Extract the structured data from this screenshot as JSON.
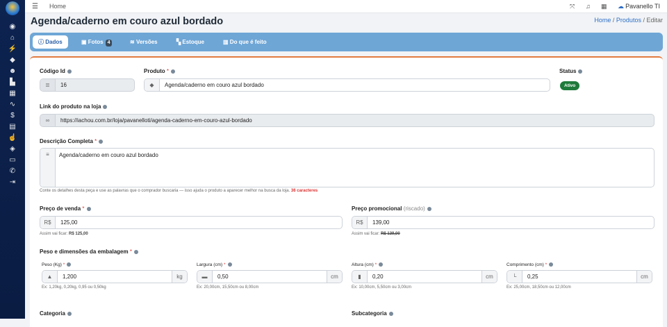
{
  "topbar": {
    "menu_icon": "menu-icon",
    "home": "Home",
    "user": "Pavanello TI"
  },
  "header": {
    "title": "Agenda/caderno em couro azul bordado",
    "crumb_home": "Home",
    "crumb_products": "Produtos",
    "crumb_edit": "Editar"
  },
  "tabs": [
    {
      "label": "Dados",
      "icon": "info-icon"
    },
    {
      "label": "Fotos",
      "icon": "images-icon",
      "badge": "4"
    },
    {
      "label": "Versões",
      "icon": "layers-icon"
    },
    {
      "label": "Estoque",
      "icon": "boxes-icon"
    },
    {
      "label": "Do que é feito",
      "icon": "trash-icon"
    }
  ],
  "form": {
    "codigo": {
      "label": "Código Id",
      "value": "16"
    },
    "produto": {
      "label": "Produto",
      "required": "*",
      "value": "Agenda/caderno em couro azul bordado"
    },
    "status": {
      "label": "Status",
      "value": "Ativo"
    },
    "link": {
      "label": "Link do produto na loja",
      "value": "https://iachou.com.br/loja/pavanelloti/agenda-caderno-em-couro-azul-bordado"
    },
    "descricao": {
      "label": "Descrição Completa",
      "required": "*",
      "value": "Agenda/caderno em couro azul bordado",
      "help": "Conte os detalhes desta peça e use as palavras que o comprador buscaria — isso ajuda o produto a aparecer melhor na busca da loja.",
      "count": "36 caracteres"
    },
    "preco": {
      "label": "Preço de venda",
      "required": "*",
      "prefix": "R$",
      "value": "125,00",
      "help_prefix": "Assim vai ficar:",
      "help_value": "R$ 125,00"
    },
    "promo": {
      "label": "Preço promocional",
      "label_note": "(riscado)",
      "prefix": "R$",
      "value": "139,00",
      "help_prefix": "Assim vai ficar:",
      "help_value": "R$ 139,00"
    },
    "dim_title": {
      "label": "Peso e dimensões da embalagem",
      "required": "*"
    },
    "peso": {
      "label": "Peso (Kg)",
      "required": "*",
      "value": "1,200",
      "suffix": "kg",
      "help": "Ex: 1,20kg, 0,20kg, 0,95 ou 0,50kg"
    },
    "largura": {
      "label": "Largura (cm)",
      "required": "*",
      "value": "0,50",
      "suffix": "cm",
      "help": "Ex: 20,00cm, 15,50cm ou 8,00cm"
    },
    "altura": {
      "label": "Altura (cm)",
      "required": "*",
      "value": "0,20",
      "suffix": "cm",
      "help": "Ex: 10,00cm, 5,50cm ou 3,00cm"
    },
    "comprimento": {
      "label": "Comprimento (cm)",
      "required": "*",
      "value": "0,25",
      "suffix": "cm",
      "help": "Ex: 25,00cm, 18,50cm ou 12,00cm"
    },
    "categoria": {
      "label": "Categoria"
    },
    "subcategoria": {
      "label": "Subcategoria"
    }
  },
  "colors": {
    "sidebar": "#0d2350",
    "tabs_bar": "#6ea6d6",
    "accent": "#e27a3f",
    "status": "#1e7a3a",
    "link": "#2f6fc6"
  }
}
